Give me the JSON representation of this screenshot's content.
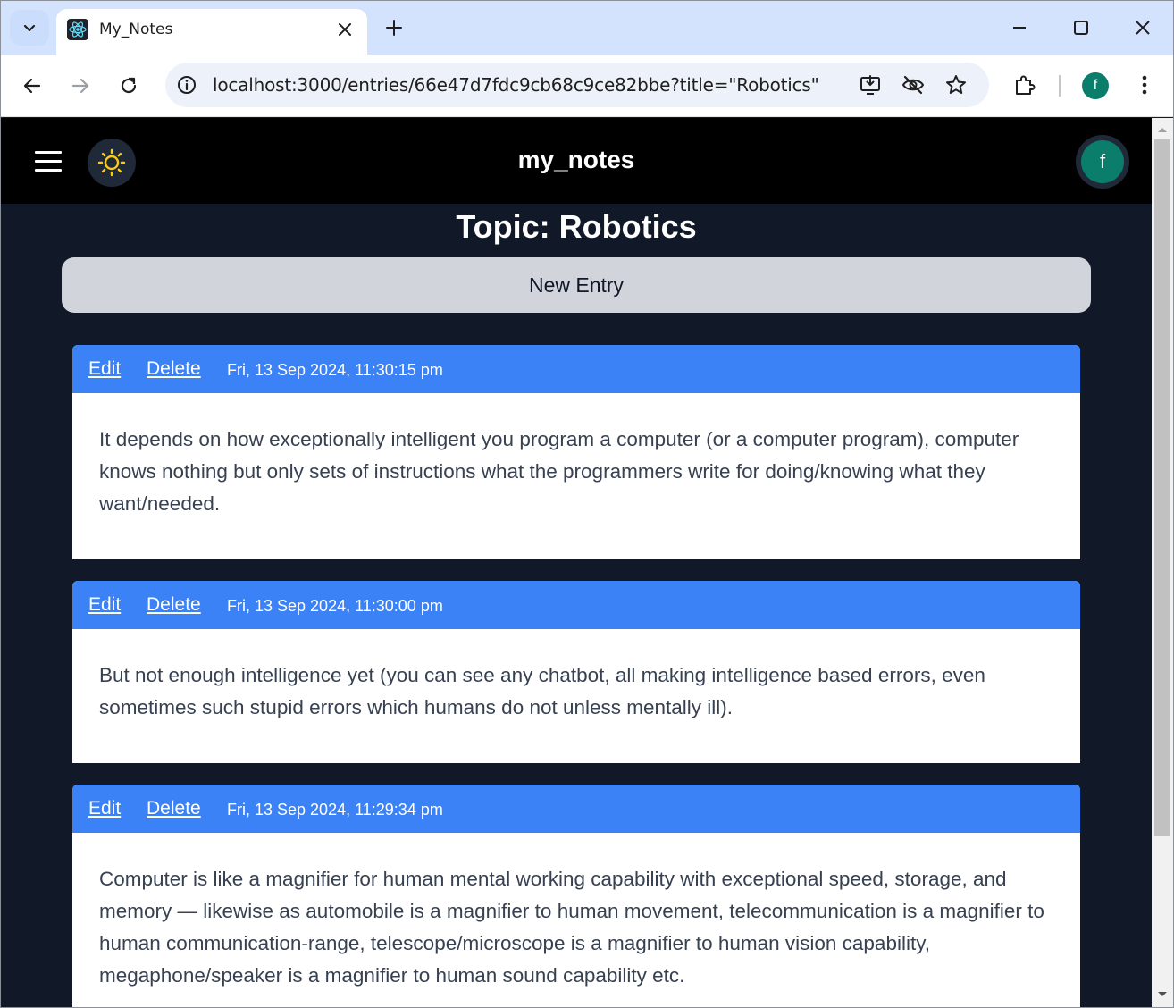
{
  "browser": {
    "tab_title": "My_Notes",
    "url": "localhost:3000/entries/66e47d7fdc9cb68c9ce82bbe?title=\"Robotics\"",
    "profile_initial": "f",
    "icons": [
      "tab-search-icon",
      "react-favicon-icon",
      "close-icon",
      "new-tab-icon",
      "minimize-icon",
      "maximize-icon",
      "window-close-icon",
      "back-icon",
      "forward-icon",
      "reload-icon",
      "site-info-icon",
      "install-app-icon",
      "eye-off-icon",
      "star-icon",
      "extensions-icon",
      "more-vert-icon"
    ]
  },
  "app": {
    "brand": "my_notes",
    "avatar_initial": "f",
    "topic_heading": "Topic: Robotics",
    "new_entry_label": "New Entry",
    "accent_color": "#3b82f6",
    "entries": [
      {
        "edit_label": "Edit",
        "delete_label": "Delete",
        "date": "Fri, 13 Sep 2024, 11:30:15 pm",
        "text": "It depends on how exceptionally intelligent you program a computer (or a computer program), computer knows nothing but only sets of instructions what the programmers write for doing/knowing what they want/needed."
      },
      {
        "edit_label": "Edit",
        "delete_label": "Delete",
        "date": "Fri, 13 Sep 2024, 11:30:00 pm",
        "text": "But not enough intelligence yet (you can see any chatbot, all making intelligence based errors, even sometimes such stupid errors which humans do not unless mentally ill)."
      },
      {
        "edit_label": "Edit",
        "delete_label": "Delete",
        "date": "Fri, 13 Sep 2024, 11:29:34 pm",
        "text": "Computer is like a magnifier for human mental working capability with exceptional speed, storage, and memory — likewise as automobile is a magnifier to human movement, telecommunication is a magnifier to human communication-range, telescope/microscope is a magnifier to human vision capability, megaphone/speaker is a magnifier to human sound capability etc."
      }
    ]
  }
}
